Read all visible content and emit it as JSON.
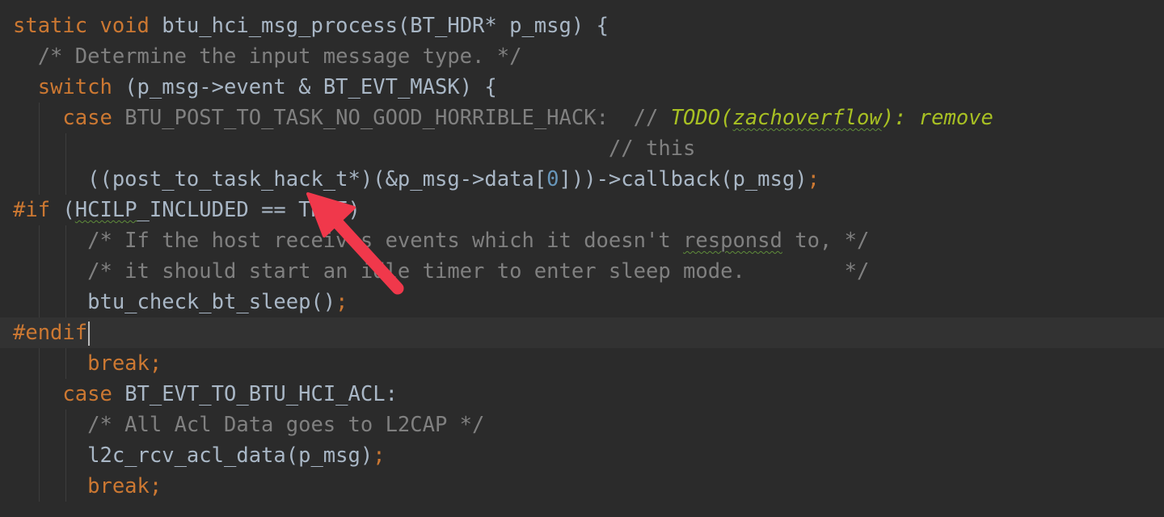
{
  "editor": {
    "language": "c",
    "theme": {
      "background": "#2b2b2b",
      "current_line": "#323232",
      "keyword": "#cc7832",
      "comment": "#808080",
      "number": "#6897bb",
      "todo": "#a8c023",
      "arrow": "#f0384b"
    },
    "lines": [
      {
        "id": "l1",
        "segs": [
          "static void",
          " btu_hci_msg_process(BT_HDR* p_msg) {"
        ]
      },
      {
        "id": "l2",
        "segs": [
          "  /* Determine the input message type. */"
        ]
      },
      {
        "id": "l3",
        "segs": [
          "  ",
          "switch",
          " (p_msg->event & BT_EVT_MASK) {"
        ]
      },
      {
        "id": "l4",
        "segs": [
          "    ",
          "case",
          " BTU_POST_TO_TASK_NO_GOOD_HORRIBLE_HACK:  // ",
          "TODO(",
          "zachoverflow",
          "): remove"
        ]
      },
      {
        "id": "l5",
        "segs": [
          "                                                // this"
        ]
      },
      {
        "id": "l6",
        "segs": [
          "      ((post_to_task_hack_t*)(&p_msg->data[",
          "0",
          "]))->callback(p_msg)",
          ";"
        ]
      },
      {
        "id": "l7",
        "segs": [
          "#if",
          " (",
          "HCILP",
          "_INCLUDED == TRUE)"
        ]
      },
      {
        "id": "l8",
        "segs": [
          "      /* If the host receives events which it doesn't ",
          "responsd",
          " to, */"
        ]
      },
      {
        "id": "l9",
        "segs": [
          "      /* it should start an idle timer to enter sleep mode.        */"
        ]
      },
      {
        "id": "l10",
        "segs": [
          "      btu_check_bt_sleep()",
          ";"
        ]
      },
      {
        "id": "l11",
        "segs": [
          "#endif"
        ]
      },
      {
        "id": "l12",
        "segs": [
          "      ",
          "break;"
        ]
      },
      {
        "id": "l13",
        "segs": [
          "    ",
          "case",
          " BT_EVT_TO_BTU_HCI_ACL:"
        ]
      },
      {
        "id": "l14",
        "segs": [
          "      /* All Acl Data goes to L2CAP */"
        ]
      },
      {
        "id": "l15",
        "segs": [
          "      l2c_rcv_acl_data(p_msg)",
          ";"
        ]
      },
      {
        "id": "l16",
        "segs": [
          "      ",
          "break;"
        ]
      }
    ]
  }
}
